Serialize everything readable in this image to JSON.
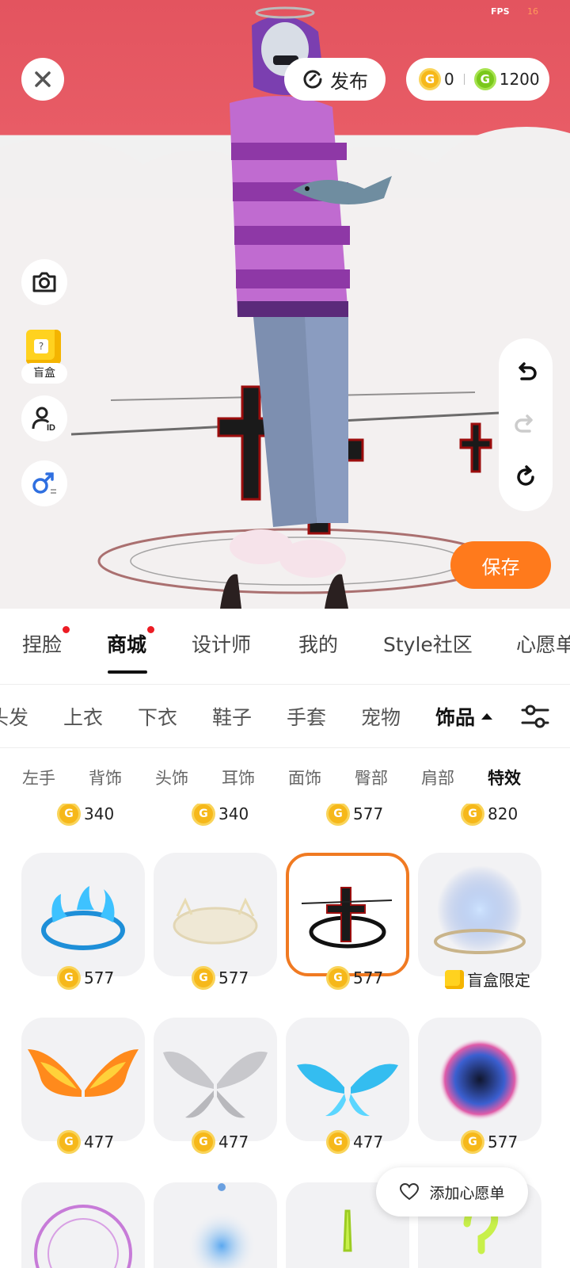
{
  "status": {
    "fps_label": "FPS",
    "fps_value": "16"
  },
  "top_bar": {
    "publish_label": "发布",
    "gold_coins": "0",
    "green_coins": "1200"
  },
  "side_tools": {
    "blind_box_label": "盲盒"
  },
  "actions": {
    "save_label": "保存"
  },
  "main_tabs": [
    {
      "label": "捏脸",
      "dot": true
    },
    {
      "label": "商城",
      "dot": true,
      "active": true
    },
    {
      "label": "设计师"
    },
    {
      "label": "我的"
    },
    {
      "label": "Style社区"
    },
    {
      "label": "心愿单"
    }
  ],
  "categories": [
    {
      "label": "头发"
    },
    {
      "label": "上衣"
    },
    {
      "label": "下衣"
    },
    {
      "label": "鞋子"
    },
    {
      "label": "手套"
    },
    {
      "label": "宠物"
    },
    {
      "label": "饰品",
      "active": true
    }
  ],
  "subcategories": [
    {
      "label": "左手"
    },
    {
      "label": "背饰"
    },
    {
      "label": "头饰"
    },
    {
      "label": "耳饰"
    },
    {
      "label": "面饰"
    },
    {
      "label": "臀部"
    },
    {
      "label": "肩部"
    },
    {
      "label": "特效",
      "active": true
    }
  ],
  "grid": {
    "row0_prices": [
      "340",
      "340",
      "577",
      "820"
    ],
    "items": [
      {
        "name": "blue-flame-circle",
        "price": "577"
      },
      {
        "name": "white-crown-circle",
        "price": "577"
      },
      {
        "name": "dark-cross-circle",
        "price": "577",
        "selected": true
      },
      {
        "name": "blue-energy-portal",
        "price_label": "盲盒限定"
      },
      {
        "name": "fire-wings",
        "price": "477"
      },
      {
        "name": "grey-butterfly-wings",
        "price": "477"
      },
      {
        "name": "ice-wings",
        "price": "477"
      },
      {
        "name": "cosmic-orb",
        "price": "577"
      },
      {
        "name": "purple-magic-circle"
      },
      {
        "name": "blue-glow"
      },
      {
        "name": "green-exclamation"
      },
      {
        "name": "green-question"
      }
    ]
  },
  "wishlist": {
    "add_label": "添加心愿单"
  },
  "colors": {
    "accent": "#FF7A1C",
    "coin_gold": "#F6B81A",
    "coin_green": "#7AC81C",
    "stage_top": "#E3545F"
  }
}
